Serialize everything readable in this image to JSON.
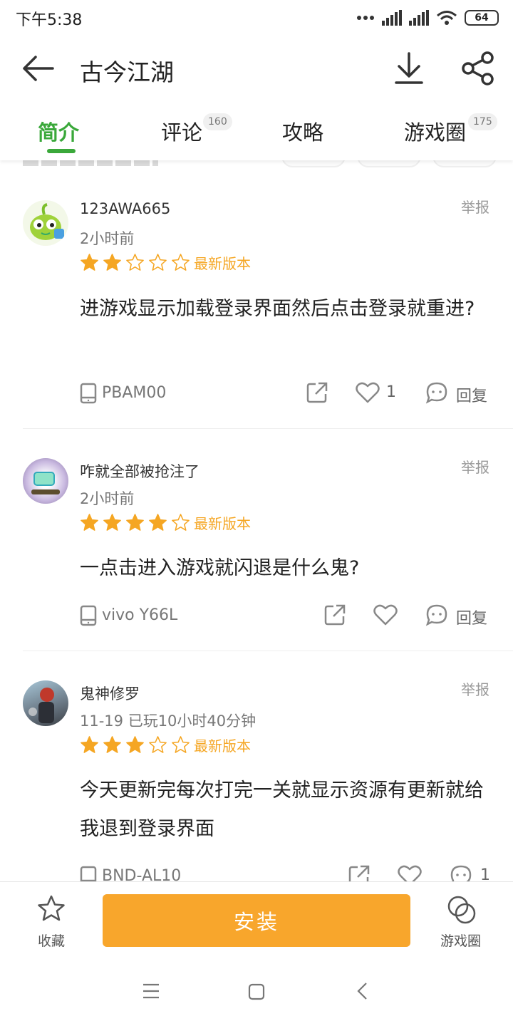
{
  "status_bar": {
    "time": "下午5:38",
    "battery": "64",
    "icons": [
      "dots-icon",
      "signal-icon",
      "signal-icon",
      "wifi-icon",
      "battery-icon"
    ]
  },
  "header": {
    "title": "古今江湖",
    "icons": [
      "back-arrow-icon",
      "download-icon",
      "share-icon"
    ]
  },
  "tabs": [
    {
      "label": "简介",
      "badge": "",
      "active": true
    },
    {
      "label": "评论",
      "badge": "160",
      "active": false
    },
    {
      "label": "攻略",
      "badge": "",
      "active": false
    },
    {
      "label": "游戏圈",
      "badge": "175",
      "active": false
    }
  ],
  "colors": {
    "accent_green": "#3aa83a",
    "star_orange": "#f5a623",
    "install_orange": "#f8a62c"
  },
  "reviews": [
    {
      "user": "123AWA665",
      "meta": "2小时前",
      "rating": 2,
      "version": "最新版本",
      "report": "举报",
      "body": "进游戏显示加载登录界面然后点击登录就重进?",
      "device": "PBAM00",
      "likes": "1",
      "reply": "回复"
    },
    {
      "user": "咋就全部被抢注了",
      "meta": "2小时前",
      "rating": 4,
      "version": "最新版本",
      "report": "举报",
      "body": "一点击进入游戏就闪退是什么鬼?",
      "device": "vivo Y66L",
      "likes": "",
      "reply": "回复"
    },
    {
      "user": "鬼神修罗",
      "meta": "11-19  已玩10小时40分钟",
      "rating": 3,
      "version": "最新版本",
      "report": "举报",
      "body": "今天更新完每次打完一关就显示资源有更新就给我退到登录界面",
      "device": "BND-AL10",
      "likes": "",
      "reply": "1"
    }
  ],
  "bottom_bar": {
    "favorite": "收藏",
    "install": "安装",
    "circle": "游戏圈"
  },
  "nav_bar": {
    "icons": [
      "menu-icon",
      "home-icon",
      "back-icon"
    ]
  }
}
